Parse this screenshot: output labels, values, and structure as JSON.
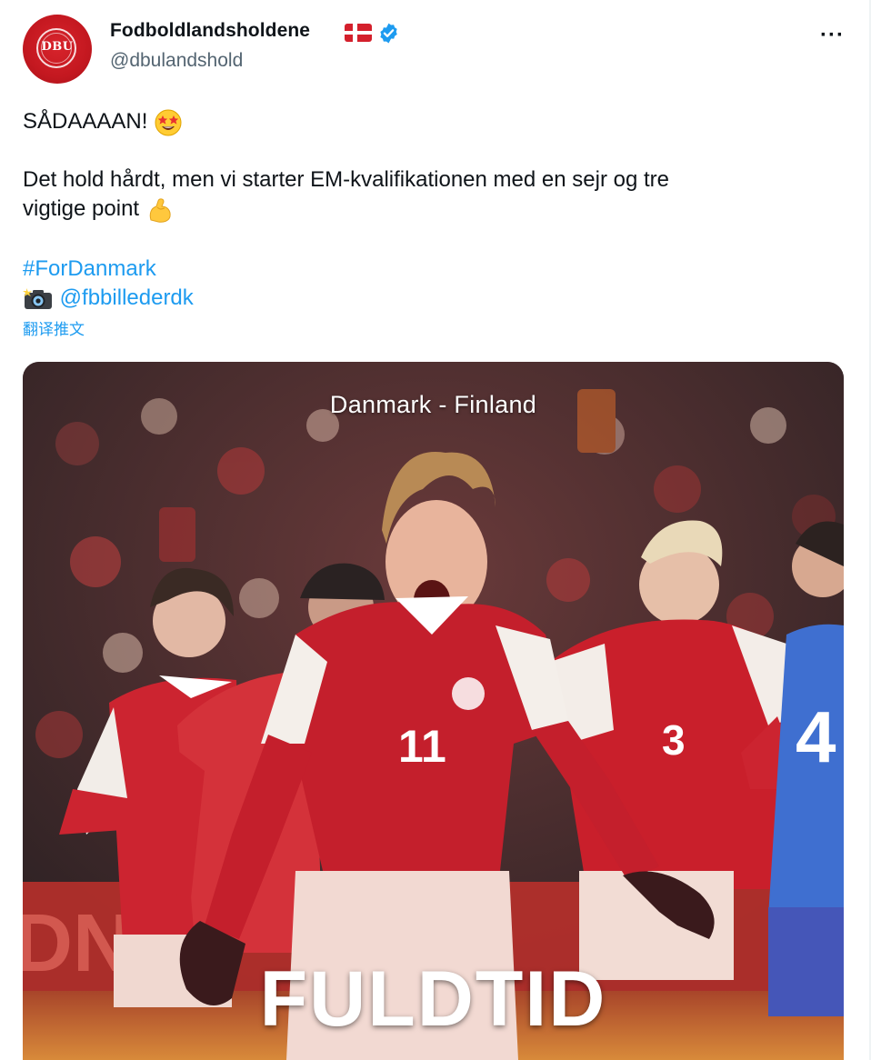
{
  "account": {
    "display_name": "Fodboldlandsholdene",
    "handle": "@dbulandshold",
    "avatar_text": "DBU",
    "more_label": "···"
  },
  "tweet": {
    "line1": "SÅDAAAAN!",
    "line2": "Det hold hårdt, men vi starter EM-kvalifikationen med en sejr og tre",
    "line3": "vigtige point",
    "hashtag": "#ForDanmark",
    "photo_credit": "@fbbillederdk",
    "translate_label": "翻译推文"
  },
  "media": {
    "match_title": "Danmark - Finland",
    "overlay_text": "FULDTID",
    "player_numbers": [
      "11",
      "3",
      "4"
    ]
  },
  "colors": {
    "link": "#1d9bf0",
    "verified": "#1d9bf0",
    "jersey_red": "#c8202a",
    "handle_gray": "#536471"
  },
  "icons": {
    "verified": "verified-badge-icon",
    "flag": "denmark-flag-icon",
    "star_eyes": "star-struck-emoji",
    "muscle": "flexed-biceps-emoji",
    "camera": "camera-flash-emoji",
    "more": "more-options-icon"
  }
}
